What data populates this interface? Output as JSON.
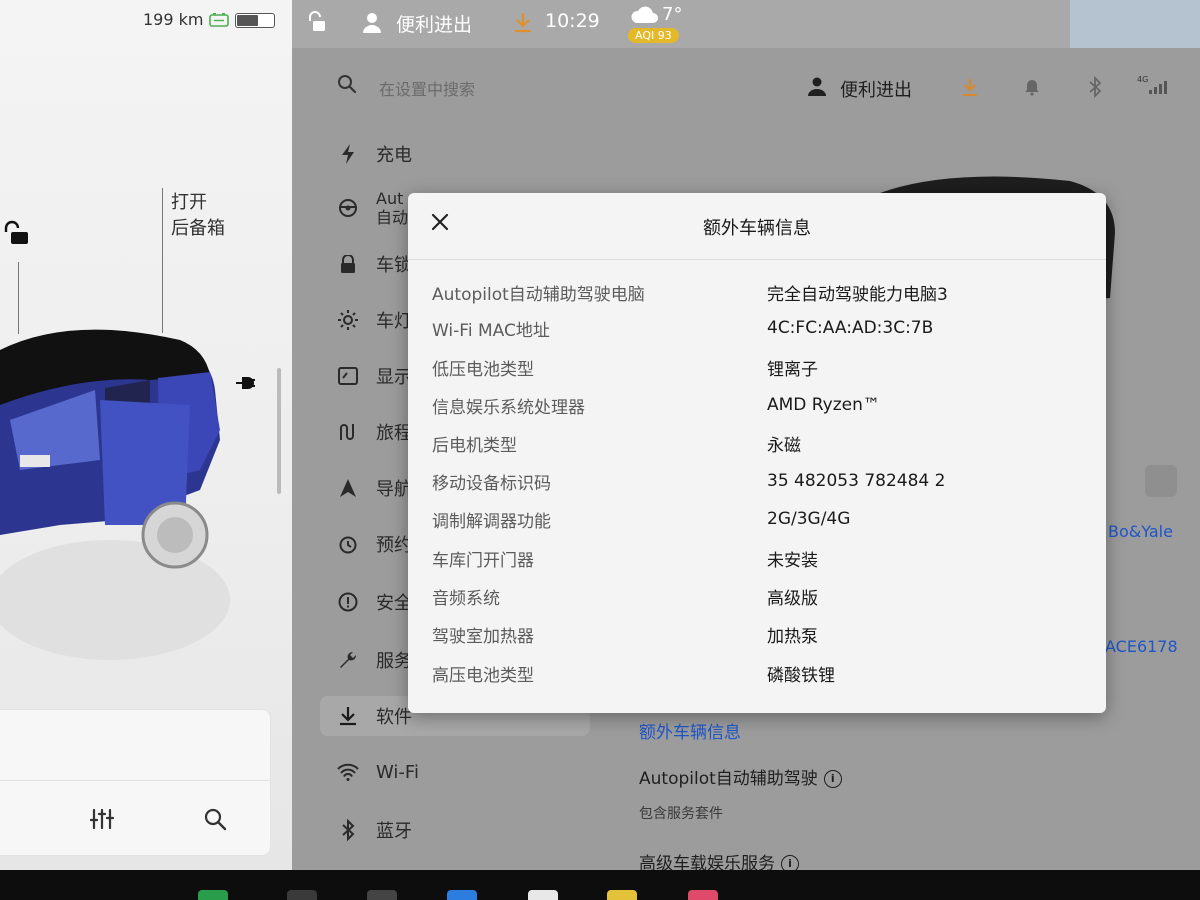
{
  "car_panel": {
    "range": "199 km",
    "trunk_label_line1": "打开",
    "trunk_label_line2": "后备箱"
  },
  "status_bar": {
    "profile": "便利进出",
    "time": "10:29",
    "temperature": "7°",
    "aqi": "AQI 93"
  },
  "settings": {
    "search_placeholder": "在设置中搜索",
    "header_profile": "便利进出",
    "signal_label": "4G",
    "menu": [
      {
        "label": "充电",
        "icon": "bolt-icon"
      },
      {
        "label": "Autopilot\n自动",
        "icon": "steering-wheel-icon"
      },
      {
        "label": "车锁",
        "icon": "lock-icon"
      },
      {
        "label": "车灯",
        "icon": "light-icon"
      },
      {
        "label": "显示",
        "icon": "display-icon"
      },
      {
        "label": "旅程",
        "icon": "trips-icon"
      },
      {
        "label": "导航",
        "icon": "navigation-icon"
      },
      {
        "label": "预约",
        "icon": "schedule-icon"
      },
      {
        "label": "安全",
        "icon": "safety-icon"
      },
      {
        "label": "服务",
        "icon": "wrench-icon"
      },
      {
        "label": "软件",
        "icon": "download-icon"
      },
      {
        "label": "Wi-Fi",
        "icon": "wifi-icon"
      },
      {
        "label": "蓝牙",
        "icon": "bluetooth-icon"
      }
    ],
    "menu_visible": [
      "充电",
      "Aut",
      "自动",
      "车锁",
      "车灯",
      "显示",
      "旅程",
      "导航",
      "预约",
      "安全",
      "服务",
      "软件",
      "Wi-Fi",
      "蓝牙"
    ],
    "right_partial_1": "Bo&Yale",
    "right_partial_2": "ACE6178",
    "extra_info_link": "额外车辆信息",
    "autopilot_title": "Autopilot自动辅助驾驶",
    "autopilot_sub": "包含服务套件",
    "premium_title": "高级车载娱乐服务"
  },
  "modal": {
    "title": "额外车辆信息",
    "rows": [
      {
        "key": "Autopilot自动辅助驾驶电脑",
        "value": "完全自动驾驶能力电脑3"
      },
      {
        "key": "Wi-Fi MAC地址",
        "value": "4C:FC:AA:AD:3C:7B"
      },
      {
        "key": "低压电池类型",
        "value": "锂离子"
      },
      {
        "key": "信息娱乐系统处理器",
        "value": "AMD Ryzen™"
      },
      {
        "key": "后电机类型",
        "value": "永磁"
      },
      {
        "key": "移动设备标识码",
        "value": "35 482053 782484 2"
      },
      {
        "key": "调制解调器功能",
        "value": "2G/3G/4G"
      },
      {
        "key": "车库门开门器",
        "value": "未安装"
      },
      {
        "key": "音频系统",
        "value": "高级版"
      },
      {
        "key": "驾驶室加热器",
        "value": "加热泵"
      },
      {
        "key": "高压电池类型",
        "value": "磷酸铁锂"
      }
    ]
  },
  "colors": {
    "accent_orange": "#e0902a",
    "aqi_badge": "#e3b92a",
    "link_blue": "#1e56c8",
    "car_blue": "#3a4aa8"
  }
}
